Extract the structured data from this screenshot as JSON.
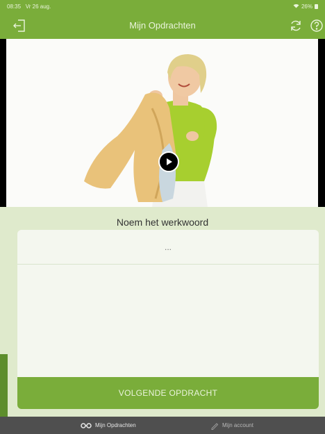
{
  "status_bar": {
    "time": "08:35",
    "date": "Vr 26 aug.",
    "battery_level": "26%"
  },
  "header": {
    "title": "Mijn Opdrachten",
    "icons": [
      "exit-icon",
      "refresh-icon",
      "help-icon"
    ]
  },
  "video": {
    "play_icon": "play-icon"
  },
  "exercise": {
    "question": "Noem het werkwoord",
    "answer_placeholder": "...",
    "next_button": "VOLGENDE OPDRACHT"
  },
  "tabbar": {
    "tabs": [
      {
        "label": "Mijn Opdrachten",
        "icon": "glasses-icon",
        "active": true
      },
      {
        "label": "Mijn account",
        "icon": "pen-icon",
        "active": false
      }
    ]
  },
  "colors": {
    "primary_green": "#7aad3a",
    "panel_background": "#dfeacc",
    "tabbar_background": "#4f4f4f"
  }
}
